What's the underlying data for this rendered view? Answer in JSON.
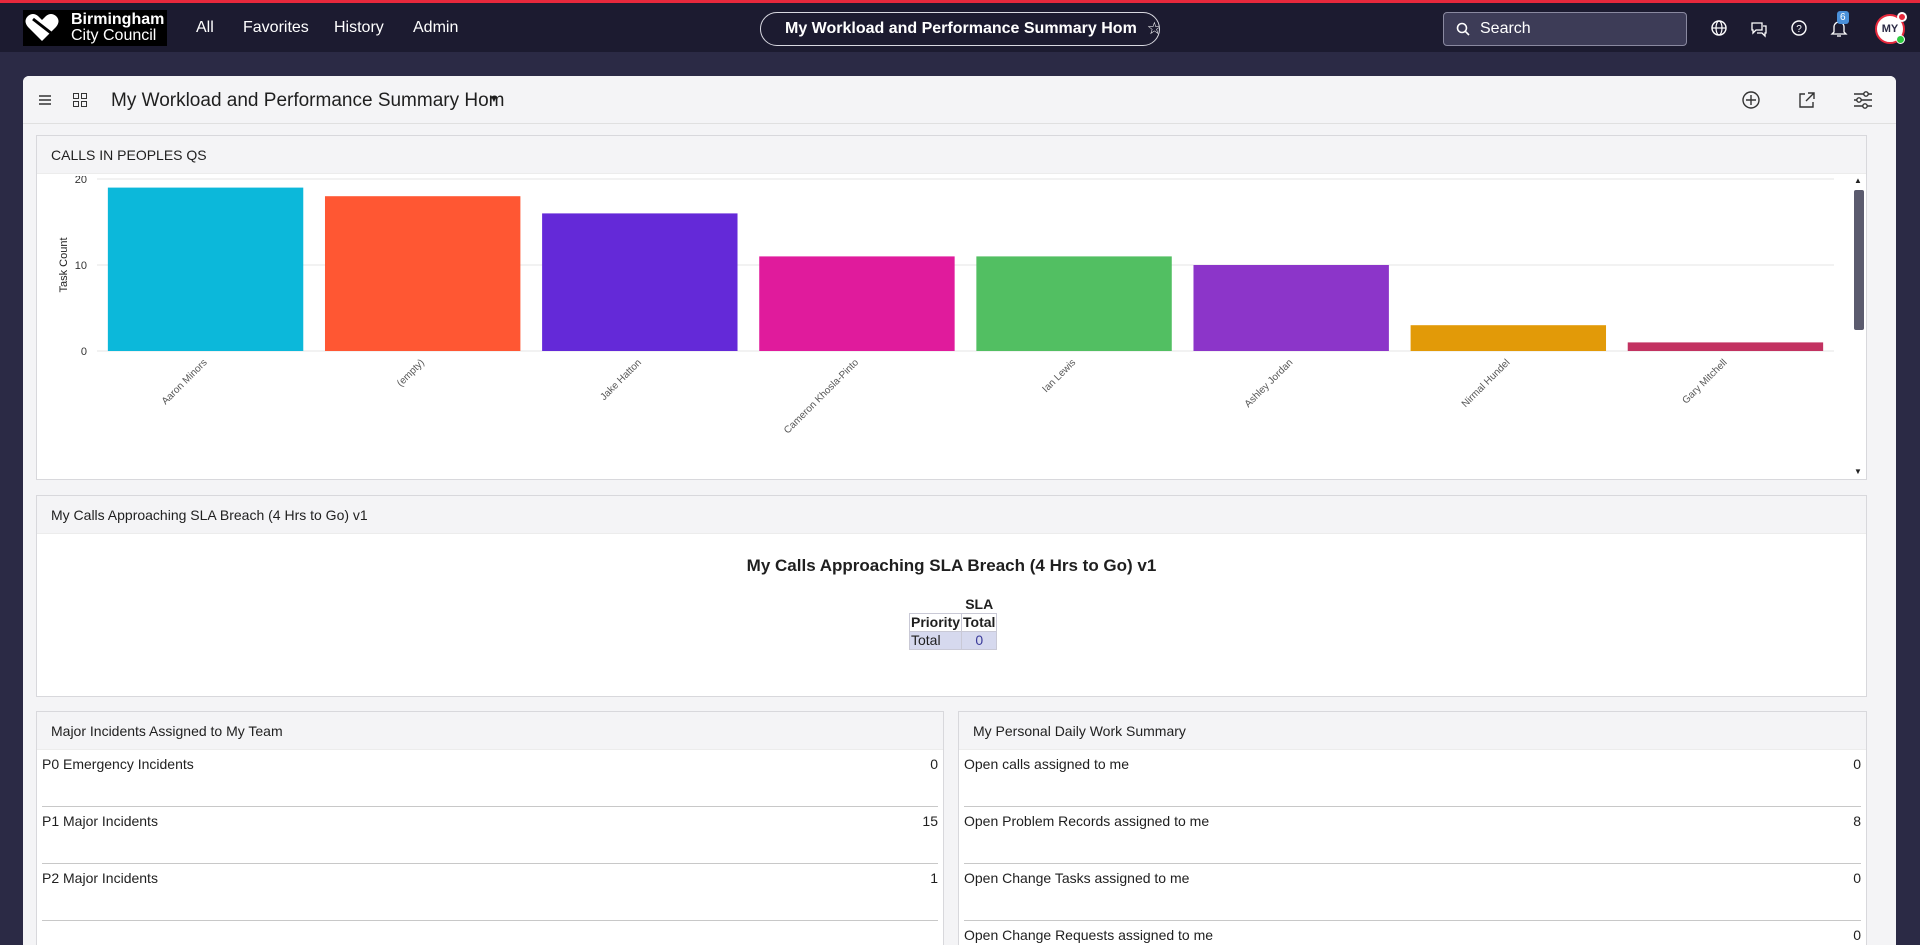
{
  "topnav": {
    "logo_line1": "Birmingham",
    "logo_line2": "City Council",
    "links": [
      "All",
      "Favorites",
      "History",
      "Admin"
    ],
    "page_title": "My Workload and Performance Summary Hom",
    "search_placeholder": "Search",
    "notification_count": "6",
    "avatar_initials": "MY",
    "accent_color": "#e6283c"
  },
  "dashboard": {
    "title": "My Workload and Performance Summary Hom"
  },
  "widgets": {
    "calls": {
      "title": "CALLS IN PEOPLES QS"
    },
    "sla": {
      "header": "My Calls Approaching SLA Breach (4 Hrs to Go) v1",
      "report_title": "My Calls Approaching SLA Breach (4 Hrs to Go) v1",
      "group_header": "SLA",
      "col_priority": "Priority",
      "col_total": "Total",
      "row_label": "Total",
      "row_value": "0"
    },
    "major": {
      "title": "Major Incidents Assigned to My Team",
      "rows": [
        {
          "label": "P0 Emergency Incidents",
          "value": "0"
        },
        {
          "label": "P1 Major Incidents",
          "value": "15"
        },
        {
          "label": "P2 Major Incidents",
          "value": "1"
        }
      ]
    },
    "daily": {
      "title": "My Personal Daily Work Summary",
      "rows": [
        {
          "label": "Open calls assigned to me",
          "value": "0"
        },
        {
          "label": "Open Problem Records assigned to me",
          "value": "8"
        },
        {
          "label": "Open Change Tasks assigned to me",
          "value": "0"
        },
        {
          "label": "Open Change Requests assigned to me",
          "value": "0"
        }
      ]
    }
  },
  "chart_data": {
    "type": "bar",
    "title": "",
    "xlabel": "",
    "ylabel": "Task Count",
    "ylim": [
      0,
      20
    ],
    "yticks": [
      "0",
      "10",
      "20"
    ],
    "grid": true,
    "categories": [
      "Aaron Minors",
      "(empty)",
      "Jake Hatton",
      "Cameron Khosla-Pinto",
      "Ian Lewis",
      "Ashley Jordan",
      "Nirmal Hundel",
      "Gary Mitchell"
    ],
    "values": [
      19,
      18,
      16,
      11,
      11,
      10,
      3,
      1
    ],
    "colors": [
      "#0cb8da",
      "#ff5733",
      "#6429d8",
      "#e01b9c",
      "#52bf62",
      "#8c35c9",
      "#e29a08",
      "#c23261"
    ]
  }
}
